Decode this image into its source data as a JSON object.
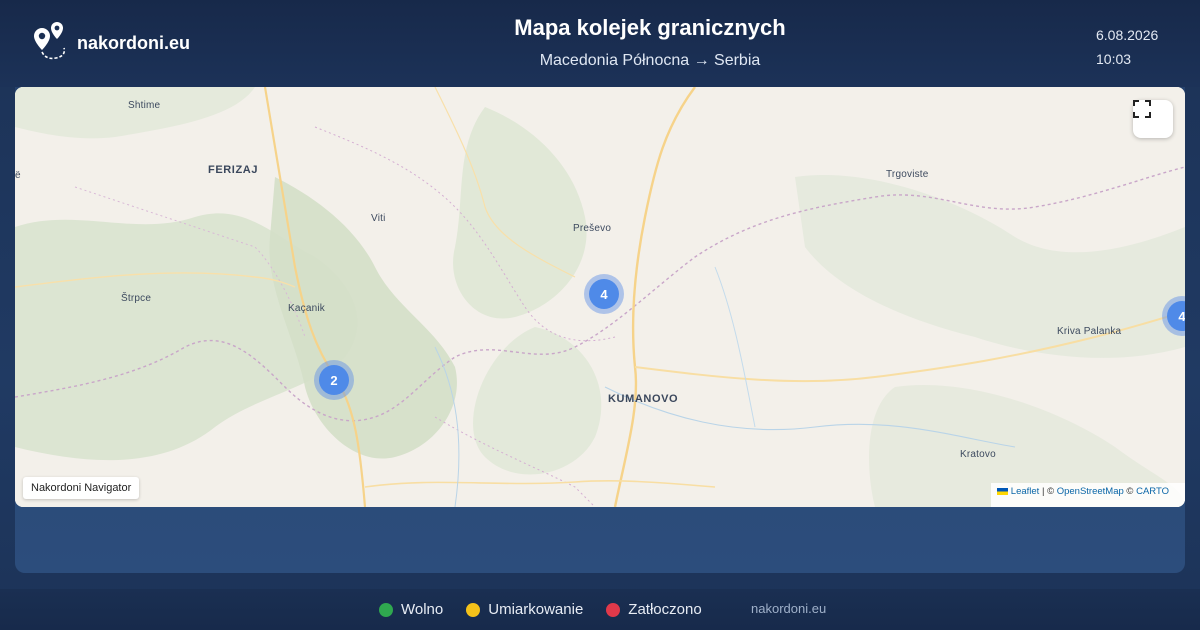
{
  "header": {
    "brand_name": "nakordoni.eu",
    "title": "Mapa kolejek granicznych",
    "subtitle": "Macedonia Północna → Serbia",
    "date": "6.08.2026",
    "time": "10:03"
  },
  "map": {
    "places": {
      "shtime": "Shtime",
      "ferizaj": "FERIZAJ",
      "viti": "Viti",
      "presevo": "Preševo",
      "trgoviste": "Trgoviste",
      "strpce": "Štrpce",
      "kacanik": "Kaçanik",
      "kriva_palanka": "Kriva Palanka",
      "kumanovo": "KUMANOVO",
      "kratovo": "Kratovo",
      "edge_label": "ë"
    },
    "clusters": {
      "presevo_count": "4",
      "kacanik_count": "2",
      "kriva_palanka_count": "4"
    },
    "badge": "Nakordoni Navigator",
    "attribution": {
      "leaflet": "Leaflet",
      "separator": " | © ",
      "osm": "OpenStreetMap",
      "copy": " © ",
      "carto": "CARTO"
    },
    "fullscreen_icon": "fullscreen-icon"
  },
  "legend": [
    {
      "label": "Wolno",
      "color": "#2fa84f"
    },
    {
      "label": "Umiarkowanie",
      "color": "#f4c21a"
    },
    {
      "label": "Zatłoczono",
      "color": "#e0394a"
    }
  ],
  "footer": {
    "site": "nakordoni.eu"
  }
}
